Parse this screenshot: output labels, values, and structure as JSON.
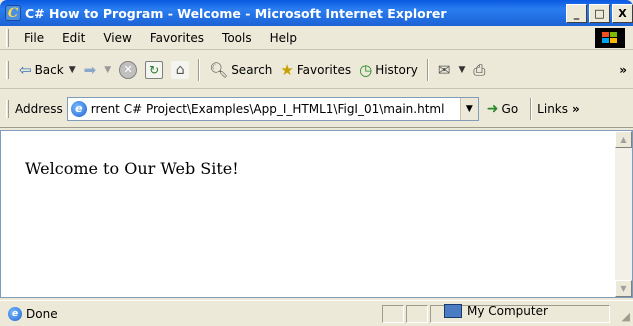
{
  "window": {
    "title": "C# How to Program - Welcome - Microsoft Internet Explorer",
    "app_icon_glyph": "C",
    "minimize": "_",
    "maximize": "□",
    "close": "X"
  },
  "menu": {
    "items": [
      "File",
      "Edit",
      "View",
      "Favorites",
      "Tools",
      "Help"
    ]
  },
  "toolbar": {
    "back_label": "Back",
    "search_label": "Search",
    "favorites_label": "Favorites",
    "history_label": "History",
    "more": "»"
  },
  "address": {
    "label": "Address",
    "value": "rrent C# Project\\Examples\\App_I_HTML1\\FigI_01\\main.html",
    "go_label": "Go",
    "links_label": "Links",
    "links_more": "»"
  },
  "page": {
    "body_text": "Welcome to Our Web Site!"
  },
  "status": {
    "text": "Done",
    "zone": "My Computer"
  }
}
